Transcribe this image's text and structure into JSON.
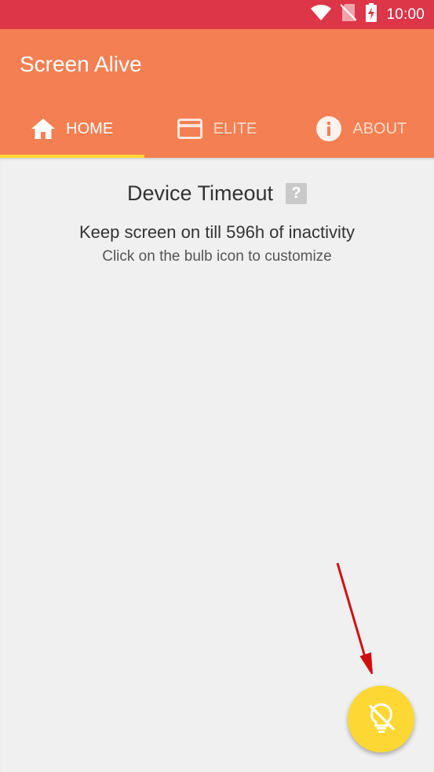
{
  "status_bar": {
    "time": "10:00",
    "icons": [
      "wifi-icon",
      "no-sim-icon",
      "battery-charging-icon"
    ]
  },
  "app": {
    "title": "Screen Alive"
  },
  "tabs": [
    {
      "label": "HOME",
      "icon": "home-icon",
      "active": true
    },
    {
      "label": "ELITE",
      "icon": "card-icon",
      "active": false
    },
    {
      "label": "ABOUT",
      "icon": "info-icon",
      "active": false
    }
  ],
  "main": {
    "title": "Device Timeout",
    "help_icon": "?",
    "keep_text": "Keep screen on till 596h of inactivity",
    "hint_text": "Click on the bulb icon to customize"
  },
  "fab": {
    "icon": "bulb-off-icon"
  },
  "colors": {
    "status_bar": "#dc3648",
    "app_bar": "#f37f52",
    "tab_indicator": "#fdd835",
    "fab": "#fdd835",
    "background": "#f0f0f0",
    "annotation_arrow": "#d01010"
  }
}
